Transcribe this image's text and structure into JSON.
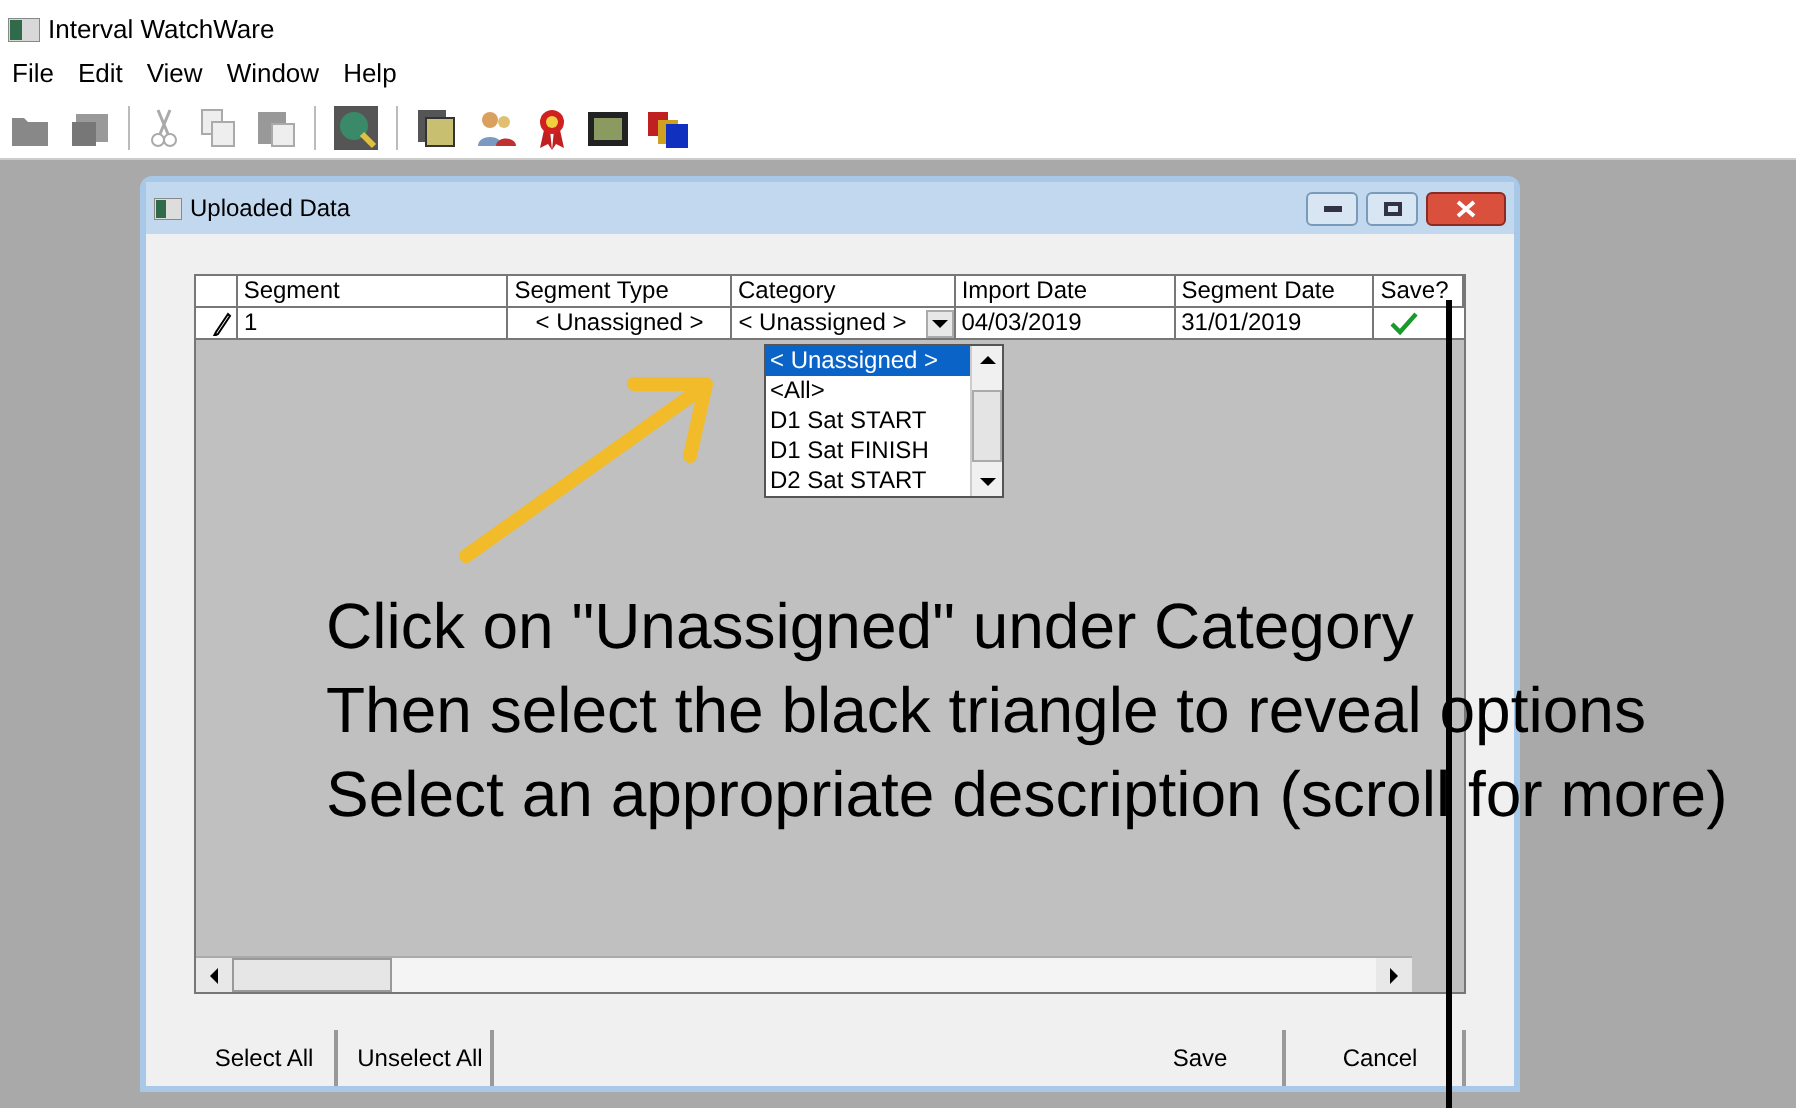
{
  "app": {
    "title": "Interval WatchWare"
  },
  "menu": [
    "File",
    "Edit",
    "View",
    "Window",
    "Help"
  ],
  "dialog": {
    "title": "Uploaded Data",
    "columns": [
      "Segment",
      "Segment Type",
      "Category",
      "Import Date",
      "Segment Date",
      "Save?"
    ],
    "rows": [
      {
        "editing": true,
        "segment": "1",
        "segment_type": "< Unassigned >",
        "category": "< Unassigned >",
        "import_date": "04/03/2019",
        "segment_date": "31/01/2019",
        "save": true
      }
    ],
    "dropdown": [
      {
        "label": "< Unassigned >",
        "selected": true
      },
      {
        "label": "<All>",
        "selected": false
      },
      {
        "label": "D1 Sat START",
        "selected": false
      },
      {
        "label": "D1 Sat FINISH",
        "selected": false
      },
      {
        "label": "D2 Sat START",
        "selected": false
      }
    ],
    "left_buttons": [
      "Select All",
      "Unselect All"
    ],
    "right_buttons": [
      "Save",
      "Cancel"
    ]
  },
  "annotation": [
    "Click on \"Unassigned\" under Category",
    "Then select the black triangle to reveal options",
    "Select an appropriate description (scroll for more)"
  ]
}
